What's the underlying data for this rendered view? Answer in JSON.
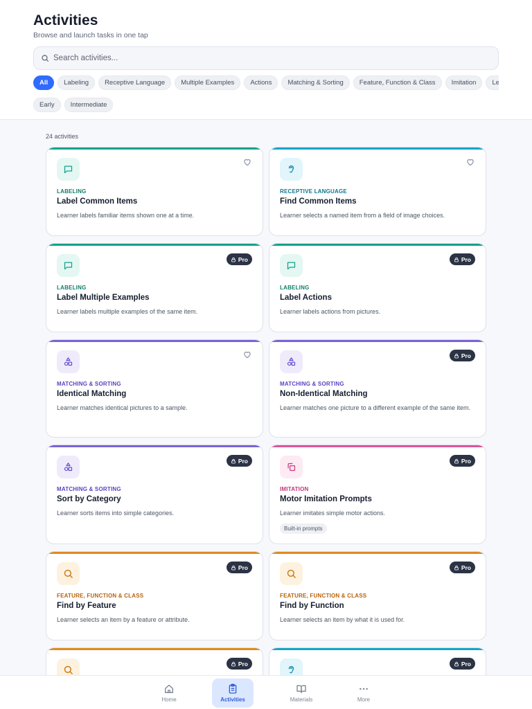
{
  "header": {
    "title": "Activities",
    "subtitle": "Browse and launch tasks in one tap"
  },
  "search": {
    "placeholder": "Search activities...",
    "icon": "search-icon"
  },
  "filters": {
    "row1": [
      "All",
      "Labeling",
      "Receptive Language",
      "Multiple Examples",
      "Actions",
      "Matching & Sorting",
      "Feature, Function & Class",
      "Imitation",
      "Le"
    ],
    "row2": [
      "Early",
      "Intermediate"
    ],
    "active": "All"
  },
  "count": "24 activities",
  "pro_label": "Pro",
  "colors": {
    "accent": "#2f6bff",
    "labeling": "#14a38b",
    "receptive": "#13a5c8",
    "matching": "#7b61d9",
    "imitation": "#e0539a",
    "feature": "#e08a1e"
  },
  "cards": [
    {
      "category": "LABELING",
      "title": "Label Common Items",
      "description": "Learner labels familiar items shown one at a time.",
      "badge": "favorite",
      "icon": "chat-bubble-icon"
    },
    {
      "category": "RECEPTIVE LANGUAGE",
      "title": "Find Common Items",
      "description": "Learner selects a named item from a field of image choices.",
      "badge": "favorite",
      "icon": "ear-icon"
    },
    {
      "category": "LABELING",
      "title": "Label Multiple Examples",
      "description": "Learner labels multiple examples of the same item.",
      "badge": "pro",
      "icon": "chat-bubble-icon"
    },
    {
      "category": "LABELING",
      "title": "Label Actions",
      "description": "Learner labels actions from pictures.",
      "badge": "pro",
      "icon": "chat-bubble-icon"
    },
    {
      "category": "MATCHING & SORTING",
      "title": "Identical Matching",
      "description": "Learner matches identical pictures to a sample.",
      "badge": "favorite",
      "icon": "shapes-icon"
    },
    {
      "category": "MATCHING & SORTING",
      "title": "Non-Identical Matching",
      "description": "Learner matches one picture to a different example of the same item.",
      "badge": "pro",
      "icon": "shapes-icon"
    },
    {
      "category": "MATCHING & SORTING",
      "title": "Sort by Category",
      "description": "Learner sorts items into simple categories.",
      "badge": "pro",
      "icon": "shapes-icon"
    },
    {
      "category": "IMITATION",
      "title": "Motor Imitation Prompts",
      "description": "Learner imitates simple motor actions.",
      "badge": "pro",
      "icon": "copy-icon",
      "tag": "Built-in prompts"
    },
    {
      "category": "FEATURE, FUNCTION & CLASS",
      "title": "Find by Feature",
      "description": "Learner selects an item by a feature or attribute.",
      "badge": "pro",
      "icon": "search-icon"
    },
    {
      "category": "FEATURE, FUNCTION & CLASS",
      "title": "Find by Function",
      "description": "Learner selects an item by what it is used for.",
      "badge": "pro",
      "icon": "search-icon"
    },
    {
      "category": "",
      "title": "",
      "description": "",
      "badge": "pro",
      "icon": "search-icon"
    },
    {
      "category": "",
      "title": "",
      "description": "",
      "badge": "pro",
      "icon": "ear-icon"
    }
  ],
  "nav": {
    "items": [
      {
        "label": "Home",
        "icon": "home-icon"
      },
      {
        "label": "Activities",
        "icon": "clipboard-icon"
      },
      {
        "label": "Materials",
        "icon": "book-icon"
      },
      {
        "label": "More",
        "icon": "more-dots-icon"
      }
    ],
    "active": "Activities"
  }
}
